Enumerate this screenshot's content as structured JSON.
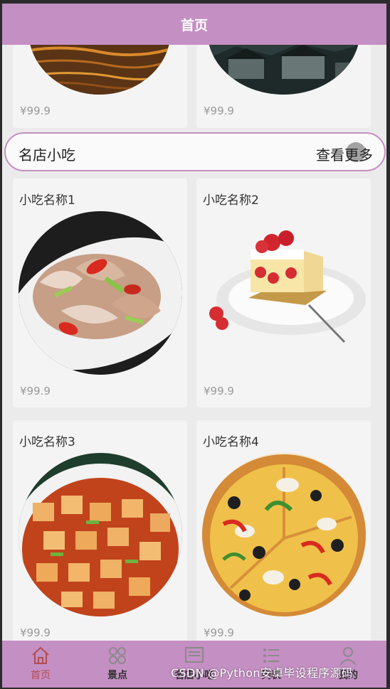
{
  "header": {
    "title": "首页"
  },
  "top_cards": [
    {
      "price": "¥99.9"
    },
    {
      "price": "¥99.9"
    }
  ],
  "section": {
    "title": "名店小吃",
    "more": "查看更多"
  },
  "snacks": [
    {
      "name": "小吃名称1",
      "price": "¥99.9"
    },
    {
      "name": "小吃名称2",
      "price": "¥99.9"
    },
    {
      "name": "小吃名称3",
      "price": "¥99.9"
    },
    {
      "name": "小吃名称4",
      "price": "¥99.9"
    }
  ],
  "tabbar": {
    "tabs": [
      {
        "label": "首页",
        "icon": "home-icon",
        "active": true
      },
      {
        "label": "景点",
        "icon": "grid-icon"
      },
      {
        "label": "名店小吃",
        "icon": "menu-board-icon"
      },
      {
        "label": "列表",
        "icon": "list-icon"
      },
      {
        "label": "我的",
        "icon": "user-icon"
      }
    ]
  },
  "watermark": "CSDN @Python安卓毕设程序源码",
  "colors": {
    "accent": "#c48fc3",
    "active_tab": "#b24c50",
    "price": "#9a9a9a"
  }
}
